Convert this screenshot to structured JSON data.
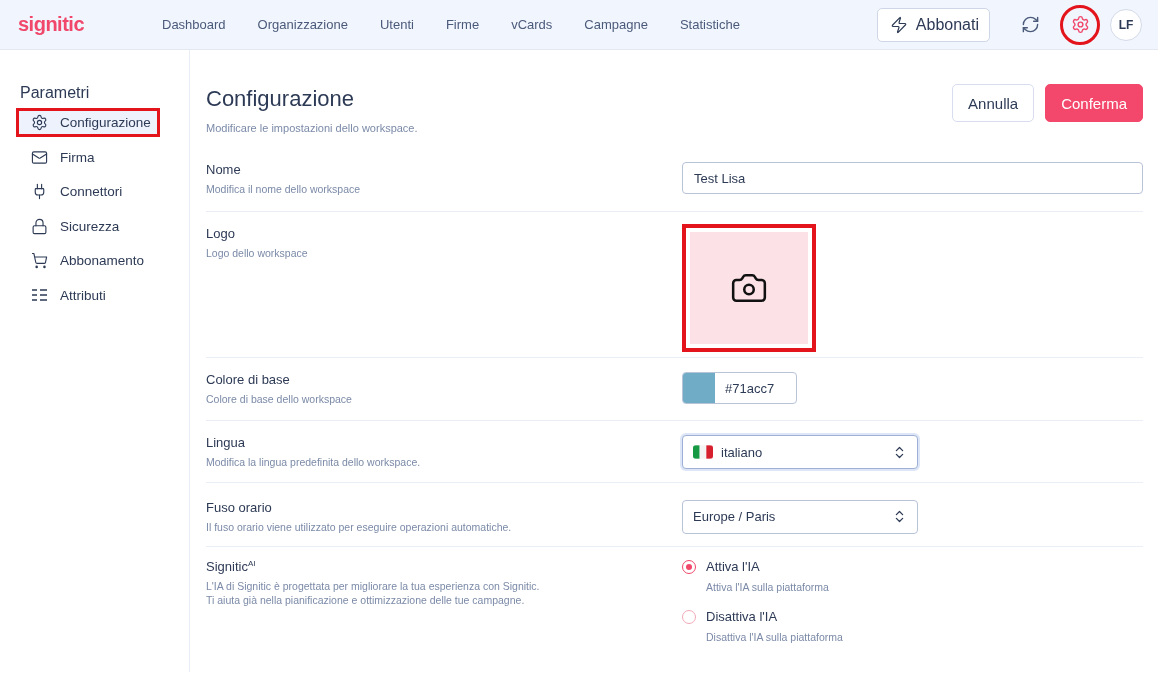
{
  "header": {
    "logo": "signitic",
    "nav": [
      {
        "label": "Dashboard",
        "selected": false
      },
      {
        "label": "Organizzazione",
        "selected": false
      },
      {
        "label": "Utenti",
        "selected": false
      },
      {
        "label": "Firme",
        "selected": false
      },
      {
        "label": "vCards",
        "selected": false
      },
      {
        "label": "Campagne",
        "selected": false
      },
      {
        "label": "Statistiche",
        "selected": false
      }
    ],
    "subscribe_button": "Abbonati",
    "settings_highlighted": true,
    "avatar": "LF"
  },
  "sidebar": {
    "title": "Parametri",
    "items": [
      {
        "label": "Configurazione",
        "selected": true,
        "highlighted": true
      },
      {
        "label": "Firma",
        "selected": false,
        "highlighted": false
      },
      {
        "label": "Connettori",
        "selected": false,
        "highlighted": false
      },
      {
        "label": "Sicurezza",
        "selected": false,
        "highlighted": false
      },
      {
        "label": "Abbonamento",
        "selected": false,
        "highlighted": false
      },
      {
        "label": "Attributi",
        "selected": false,
        "highlighted": false
      }
    ]
  },
  "page": {
    "title": "Configurazione",
    "subtitle": "Modificare le impostazioni dello workspace.",
    "cancel_button": "Annulla",
    "confirm_button": "Conferma"
  },
  "fields": [
    {
      "kind": "text",
      "label": "Nome",
      "description": "Modifica il nome dello workspace",
      "value": "Test Lisa"
    },
    {
      "kind": "logo",
      "label": "Logo",
      "description": "Logo dello workspace",
      "highlighted": true
    },
    {
      "kind": "color",
      "label": "Colore di base",
      "description": "Colore di base dello workspace",
      "color": "#71acc7",
      "value": "#71acc7"
    },
    {
      "kind": "language",
      "label": "Lingua",
      "description": "Modifica la lingua predefinita dello workspace.",
      "value": "italiano",
      "focused": true
    },
    {
      "kind": "select",
      "label": "Fuso orario",
      "description": "Il fuso orario viene utilizzato per eseguire operazioni automatiche.",
      "value": "Europe / Paris",
      "focused": false
    },
    {
      "kind": "radio",
      "label": "Signitic$^{AI}$",
      "description": "L'IA di Signitic è progettata per migliorare la tua esperienza con Signitic.\nTi aiuta già nella pianificazione e ottimizzazione delle tue campagne.",
      "options": [
        {
          "label": "Attiva l'IA",
          "description": "Attiva l'IA sulla piattaforma",
          "selected": true
        },
        {
          "label": "Disattiva l'IA",
          "description": "Disattiva l'IA sulla piattaforma",
          "selected": false
        }
      ]
    }
  ]
}
